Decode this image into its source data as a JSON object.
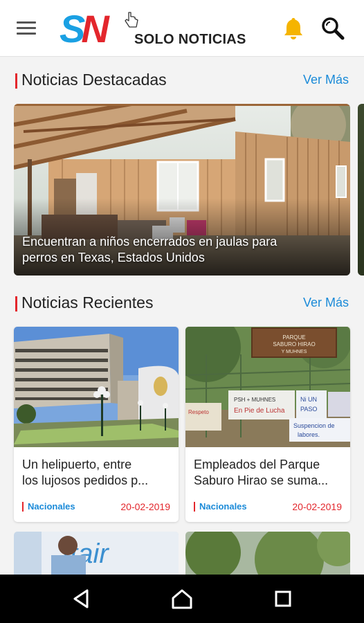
{
  "header": {
    "logo_mark_s": "S",
    "logo_mark_n": "N",
    "logo_text": "SOLO NOTICIAS",
    "icons": [
      "menu-icon",
      "bell-icon",
      "search-icon"
    ],
    "colors": {
      "brand_blue": "#1aa0e3",
      "brand_red": "#e3262c",
      "bell": "#f5b400"
    }
  },
  "featured": {
    "title": "Noticias Destacadas",
    "see_more": "Ver Más",
    "item": {
      "line1": "Encuentran a niños encerrados en jaulas para",
      "line2": "perros en Texas, Estados Unidos"
    }
  },
  "recent": {
    "title": "Noticias Recientes",
    "see_more": "Ver Más",
    "items": [
      {
        "line1": "Un helipuerto, entre",
        "line2": "los lujosos pedidos p...",
        "category": "Nacionales",
        "date": "20-02-2019"
      },
      {
        "line1": "Empleados del Parque",
        "line2": "Saburo Hirao se suma...",
        "category": "Nacionales",
        "date": "20-02-2019"
      }
    ]
  },
  "photo_signs": {
    "sign1": "PARQUE SABURO HIRAO Y MUHNES",
    "sign2": "PSH + MUHNES En Pie de Lucha",
    "sign3": "Ni UN PASO",
    "sign4": "Suspencion de labores"
  },
  "nav": {
    "icons": [
      "back-icon",
      "home-icon",
      "recents-icon"
    ]
  }
}
